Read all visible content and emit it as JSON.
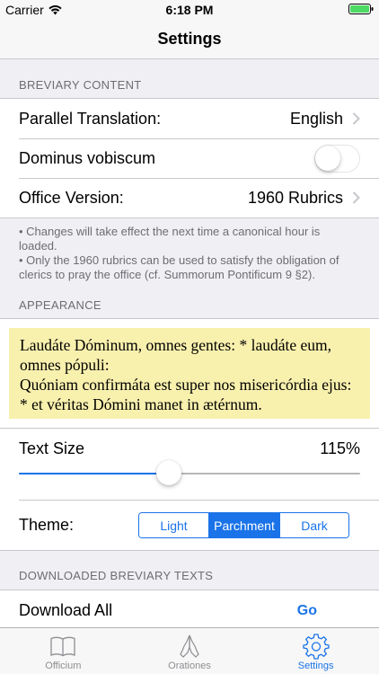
{
  "status_bar": {
    "carrier": "Carrier",
    "time": "6:18 PM",
    "battery_color": "#4cd964"
  },
  "nav": {
    "title": "Settings"
  },
  "sections": {
    "breviary_content": {
      "header": "BREVIARY CONTENT",
      "parallel_translation_label": "Parallel Translation:",
      "parallel_translation_value": "English",
      "dominus_vobiscum_label": "Dominus vobiscum",
      "dominus_vobiscum_on": false,
      "office_version_label": "Office Version:",
      "office_version_value": "1960 Rubrics",
      "footer_line1": "• Changes will take effect the next time a canonical hour is loaded.",
      "footer_line2": "• Only the 1960 rubrics can be used to satisfy the obligation of clerics to pray the office (cf. Summorum Pontificum 9 §2)."
    },
    "appearance": {
      "header": "APPEARANCE",
      "preview_line1": "Laudáte Dóminum, omnes gentes: * laudáte eum, omnes pópuli:",
      "preview_line2": "Quóniam confirmáta est super nos misericórdia ejus: * et véritas Dómini manet in ætérnum.",
      "text_size_label": "Text Size",
      "text_size_value": "115%",
      "text_size_fraction": 0.44,
      "theme_label": "Theme:",
      "theme_options": [
        "Light",
        "Parchment",
        "Dark"
      ],
      "theme_selected": "Parchment",
      "parchment_color": "#f8f0ad"
    },
    "downloaded": {
      "header": "DOWNLOADED BREVIARY TEXTS",
      "download_all_label": "Download All",
      "go_label": "Go"
    }
  },
  "tab_bar": {
    "tabs": [
      {
        "label": "Officium",
        "icon": "book-icon"
      },
      {
        "label": "Orationes",
        "icon": "praying-hands-icon"
      },
      {
        "label": "Settings",
        "icon": "gear-icon"
      }
    ],
    "active": "Settings"
  },
  "accent_color": "#1a73e8"
}
